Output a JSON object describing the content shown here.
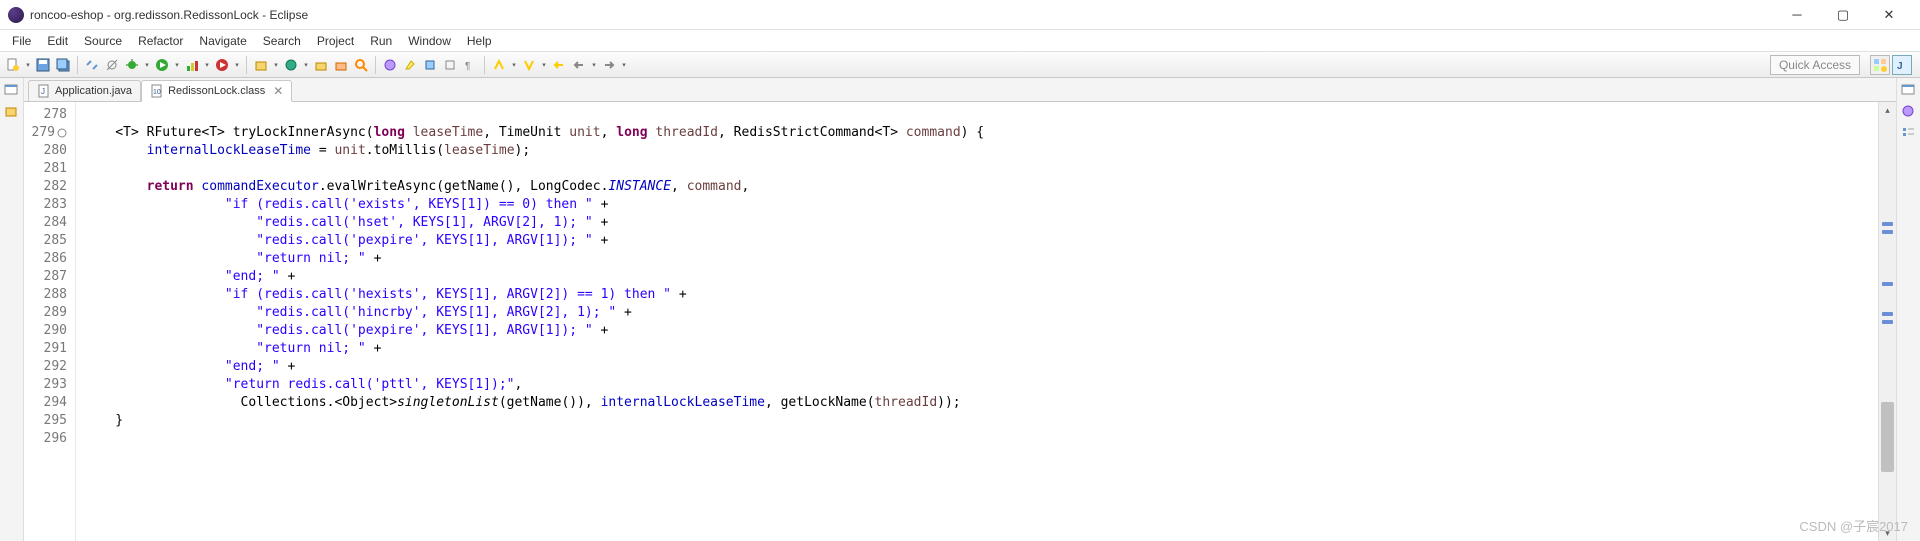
{
  "window": {
    "title": "roncoo-eshop - org.redisson.RedissonLock - Eclipse"
  },
  "menu": [
    "File",
    "Edit",
    "Source",
    "Refactor",
    "Navigate",
    "Search",
    "Project",
    "Run",
    "Window",
    "Help"
  ],
  "quick_access": "Quick Access",
  "tabs": [
    {
      "label": "Application.java",
      "active": false
    },
    {
      "label": "RedissonLock.class",
      "active": true
    }
  ],
  "chart_data": {
    "type": "code",
    "language": "java",
    "first_line": 278,
    "lines": [
      "",
      "    <T> RFuture<T> tryLockInnerAsync(long leaseTime, TimeUnit unit, long threadId, RedisStrictCommand<T> command) {",
      "        internalLockLeaseTime = unit.toMillis(leaseTime);",
      "",
      "        return commandExecutor.evalWriteAsync(getName(), LongCodec.INSTANCE, command,",
      "                  \"if (redis.call('exists', KEYS[1]) == 0) then \" +",
      "                      \"redis.call('hset', KEYS[1], ARGV[2], 1); \" +",
      "                      \"redis.call('pexpire', KEYS[1], ARGV[1]); \" +",
      "                      \"return nil; \" +",
      "                  \"end; \" +",
      "                  \"if (redis.call('hexists', KEYS[1], ARGV[2]) == 1) then \" +",
      "                      \"redis.call('hincrby', KEYS[1], ARGV[2], 1); \" +",
      "                      \"redis.call('pexpire', KEYS[1], ARGV[1]); \" +",
      "                      \"return nil; \" +",
      "                  \"end; \" +",
      "                  \"return redis.call('pttl', KEYS[1]);\",",
      "                    Collections.<Object>singletonList(getName()), internalLockLeaseTime, getLockName(threadId));",
      "    }",
      ""
    ]
  },
  "watermark": "CSDN @子宸2017"
}
